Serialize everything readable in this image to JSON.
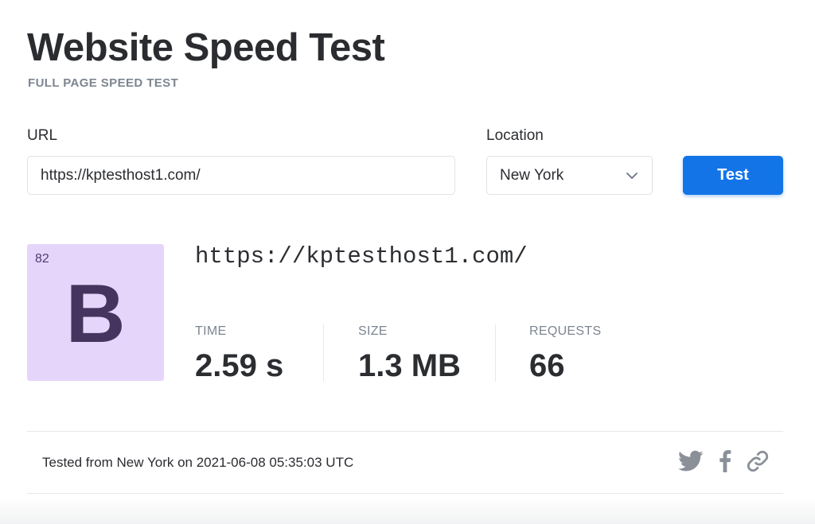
{
  "header": {
    "title": "Website Speed Test",
    "subtitle": "FULL PAGE SPEED TEST"
  },
  "form": {
    "url_label": "URL",
    "url_value": "https://kptesthost1.com/",
    "location_label": "Location",
    "location_value": "New York",
    "test_button": "Test"
  },
  "result": {
    "score": "82",
    "grade": "B",
    "url": "https://kptesthost1.com/",
    "metrics": {
      "time_label": "TIME",
      "time_value": "2.59 s",
      "size_label": "SIZE",
      "size_value": "1.3 MB",
      "requests_label": "REQUESTS",
      "requests_value": "66"
    }
  },
  "footer": {
    "tested_text": "Tested from New York on 2021-06-08 05:35:03 UTC",
    "share_icons": [
      "twitter-icon",
      "facebook-icon",
      "link-icon"
    ]
  },
  "colors": {
    "accent": "#1374e8",
    "grade_bg": "#e5d5fb",
    "grade_fg": "#45345e",
    "muted": "#7d8590"
  }
}
